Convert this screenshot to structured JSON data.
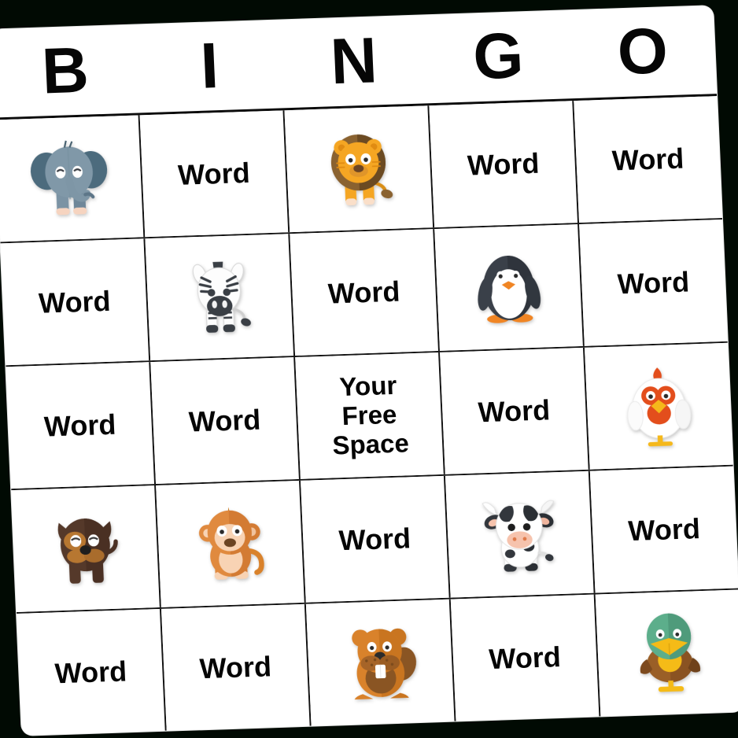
{
  "background_color": "#010a03",
  "card": {
    "background_color": "#ffffff",
    "border_color": "#111111",
    "rotation_degrees": -1.9
  },
  "header": {
    "letters": [
      "B",
      "I",
      "N",
      "G",
      "O"
    ]
  },
  "labels": {
    "word": "Word",
    "free_space": "Your\nFree\nSpace"
  },
  "grid": {
    "columns": 5,
    "rows": 5,
    "cells": [
      [
        {
          "type": "image",
          "icon": "elephant-icon",
          "name": "elephant"
        },
        {
          "type": "text",
          "text": "Word"
        },
        {
          "type": "image",
          "icon": "lion-icon",
          "name": "lion"
        },
        {
          "type": "text",
          "text": "Word"
        },
        {
          "type": "text",
          "text": "Word"
        }
      ],
      [
        {
          "type": "text",
          "text": "Word"
        },
        {
          "type": "image",
          "icon": "zebra-icon",
          "name": "zebra"
        },
        {
          "type": "text",
          "text": "Word"
        },
        {
          "type": "image",
          "icon": "penguin-icon",
          "name": "penguin"
        },
        {
          "type": "text",
          "text": "Word"
        }
      ],
      [
        {
          "type": "text",
          "text": "Word"
        },
        {
          "type": "text",
          "text": "Word"
        },
        {
          "type": "free",
          "text": "Your\nFree\nSpace"
        },
        {
          "type": "text",
          "text": "Word"
        },
        {
          "type": "image",
          "icon": "chicken-icon",
          "name": "chicken"
        }
      ],
      [
        {
          "type": "image",
          "icon": "dog-icon",
          "name": "dog"
        },
        {
          "type": "image",
          "icon": "monkey-icon",
          "name": "monkey"
        },
        {
          "type": "text",
          "text": "Word"
        },
        {
          "type": "image",
          "icon": "cow-icon",
          "name": "cow"
        },
        {
          "type": "text",
          "text": "Word"
        }
      ],
      [
        {
          "type": "text",
          "text": "Word"
        },
        {
          "type": "text",
          "text": "Word"
        },
        {
          "type": "image",
          "icon": "beaver-icon",
          "name": "beaver"
        },
        {
          "type": "text",
          "text": "Word"
        },
        {
          "type": "image",
          "icon": "duck-icon",
          "name": "duck"
        }
      ]
    ]
  },
  "art_colors": {
    "elephant_body": "#8098a8",
    "elephant_ear": "#4c6b7d",
    "elephant_foot": "#f6d4c0",
    "lion_face": "#f5a623",
    "lion_mane": "#6b4a22",
    "lion_mane_light": "#8a6230",
    "zebra_body": "#fdfdfd",
    "zebra_stripe": "#3a3f45",
    "penguin_body": "#3a4049",
    "penguin_belly": "#ffffff",
    "penguin_beak": "#f08524",
    "chicken_body": "#ffffff",
    "chicken_face": "#e34e1c",
    "chicken_beak": "#f5b81b",
    "dog_body": "#55392a",
    "dog_patch": "#b77731",
    "monkey_body": "#e08a3f",
    "monkey_face": "#f8d3b4",
    "cow_body": "#ffffff",
    "cow_spot": "#33373d",
    "cow_muzzle": "#f6c3ad",
    "beaver_body": "#d9822b",
    "beaver_belly": "#8a5523",
    "beaver_teeth": "#ffffff",
    "duck_head": "#5cae8b",
    "duck_bill": "#f5bb17",
    "duck_body": "#9a5f27"
  }
}
